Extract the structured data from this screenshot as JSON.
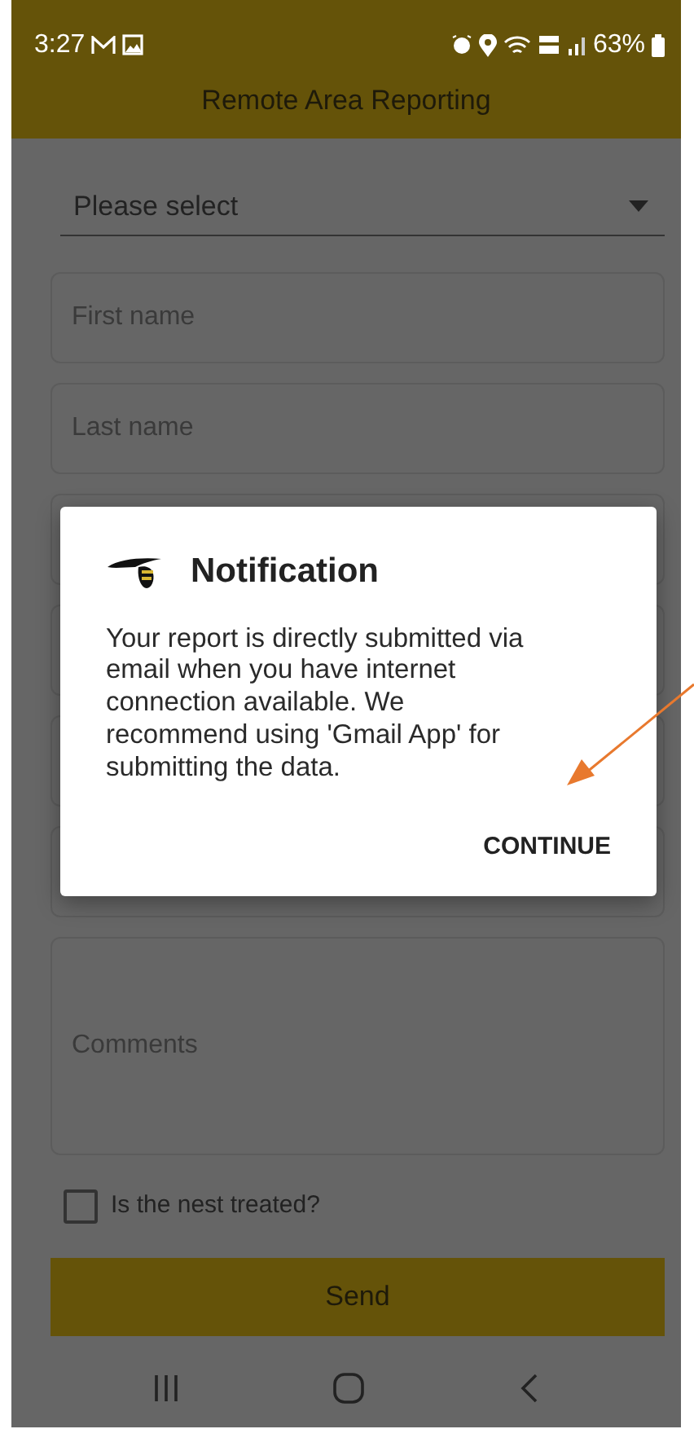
{
  "status_bar": {
    "time": "3:27",
    "battery": "63%"
  },
  "app_bar": {
    "title": "Remote Area Reporting"
  },
  "form": {
    "fields": [
      {
        "kind": "select",
        "placeholder": "Please select"
      },
      {
        "kind": "input",
        "placeholder": "First name"
      },
      {
        "kind": "input",
        "placeholder": "Last name"
      },
      {
        "kind": "input"
      },
      {
        "kind": "input"
      },
      {
        "kind": "input"
      },
      {
        "kind": "input"
      },
      {
        "kind": "textarea",
        "placeholder": "Comments"
      }
    ],
    "checkbox": {
      "label": "Is the nest treated?",
      "checked": false
    },
    "submit": {
      "label": "Send"
    }
  },
  "dialog": {
    "title": "Notification",
    "message": "Your report is directly submitted via email when you have internet connection available. We recommend using 'Gmail App' for submitting the data.",
    "button": "CONTINUE"
  }
}
